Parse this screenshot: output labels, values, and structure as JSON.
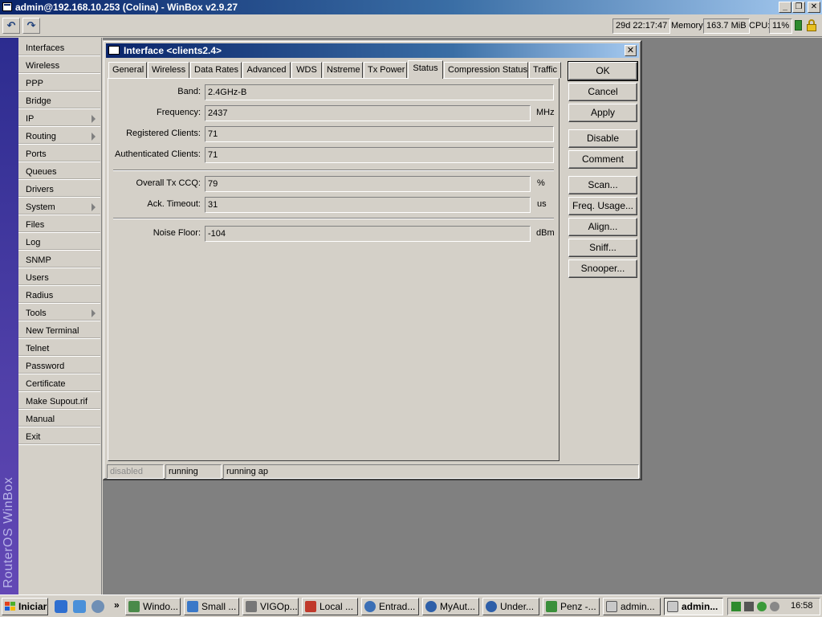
{
  "window": {
    "title": "admin@192.168.10.253 (Colina) - WinBox v2.9.27",
    "minimize_glyph": "_",
    "maximize_glyph": "❐",
    "close_glyph": "✕"
  },
  "toolbar": {
    "undo_icon": "↶",
    "redo_icon": "↷",
    "uptime": "29d 22:17:47",
    "memory_label": "Memory:",
    "memory_value": "163.7 MiB",
    "cpu_label": "CPU:",
    "cpu_value": "11%"
  },
  "brand": {
    "text": "RouterOS WinBox"
  },
  "sidebar": {
    "items": [
      {
        "label": "Interfaces"
      },
      {
        "label": "Wireless"
      },
      {
        "label": "PPP"
      },
      {
        "label": "Bridge"
      },
      {
        "label": "IP",
        "submenu": true
      },
      {
        "label": "Routing",
        "submenu": true
      },
      {
        "label": "Ports"
      },
      {
        "label": "Queues"
      },
      {
        "label": "Drivers"
      },
      {
        "label": "System",
        "submenu": true
      },
      {
        "label": "Files"
      },
      {
        "label": "Log"
      },
      {
        "label": "SNMP"
      },
      {
        "label": "Users"
      },
      {
        "label": "Radius"
      },
      {
        "label": "Tools",
        "submenu": true
      },
      {
        "label": "New Terminal"
      },
      {
        "label": "Telnet"
      },
      {
        "label": "Password"
      },
      {
        "label": "Certificate"
      },
      {
        "label": "Make Supout.rif"
      },
      {
        "label": "Manual"
      },
      {
        "label": "Exit"
      }
    ]
  },
  "dialog": {
    "title": "Interface <clients2.4>",
    "close_glyph": "✕",
    "tabs": [
      {
        "label": "General"
      },
      {
        "label": "Wireless"
      },
      {
        "label": "Data Rates"
      },
      {
        "label": "Advanced"
      },
      {
        "label": "WDS"
      },
      {
        "label": "Nstreme"
      },
      {
        "label": "Tx Power"
      },
      {
        "label": "Status",
        "active": true
      },
      {
        "label": "Compression Status"
      },
      {
        "label": "Traffic"
      }
    ],
    "fields": {
      "band": {
        "label": "Band:",
        "value": "2.4GHz-B",
        "unit": ""
      },
      "frequency": {
        "label": "Frequency:",
        "value": "2437",
        "unit": "MHz"
      },
      "registered_clients": {
        "label": "Registered Clients:",
        "value": "71",
        "unit": ""
      },
      "authenticated_clients": {
        "label": "Authenticated Clients:",
        "value": "71",
        "unit": ""
      },
      "overall_tx_ccq": {
        "label": "Overall Tx CCQ:",
        "value": "79",
        "unit": "%"
      },
      "ack_timeout": {
        "label": "Ack. Timeout:",
        "value": "31",
        "unit": "us"
      },
      "noise_floor": {
        "label": "Noise Floor:",
        "value": "-104",
        "unit": "dBm"
      }
    },
    "buttons": {
      "ok": "OK",
      "cancel": "Cancel",
      "apply": "Apply",
      "disable": "Disable",
      "comment": "Comment",
      "scan": "Scan...",
      "freq_usage": "Freq. Usage...",
      "align": "Align...",
      "sniff": "Sniff...",
      "snooper": "Snooper..."
    },
    "status": {
      "disabled": "disabled",
      "running": "running",
      "mode": "running ap"
    }
  },
  "taskbar": {
    "start_label": "Iniciar",
    "more_glyph": "»",
    "tasks": [
      {
        "label": "Windo...",
        "active": false
      },
      {
        "label": "Small ...",
        "active": false
      },
      {
        "label": "VIGOp...",
        "active": false
      },
      {
        "label": "Local ...",
        "active": false
      },
      {
        "label": "Entrad...",
        "active": false
      },
      {
        "label": "MyAut...",
        "active": false
      },
      {
        "label": "Under...",
        "active": false
      },
      {
        "label": "Penz -...",
        "active": false
      },
      {
        "label": "admin...",
        "active": false
      },
      {
        "label": "admin...",
        "active": true
      }
    ],
    "clock": "16:58"
  }
}
